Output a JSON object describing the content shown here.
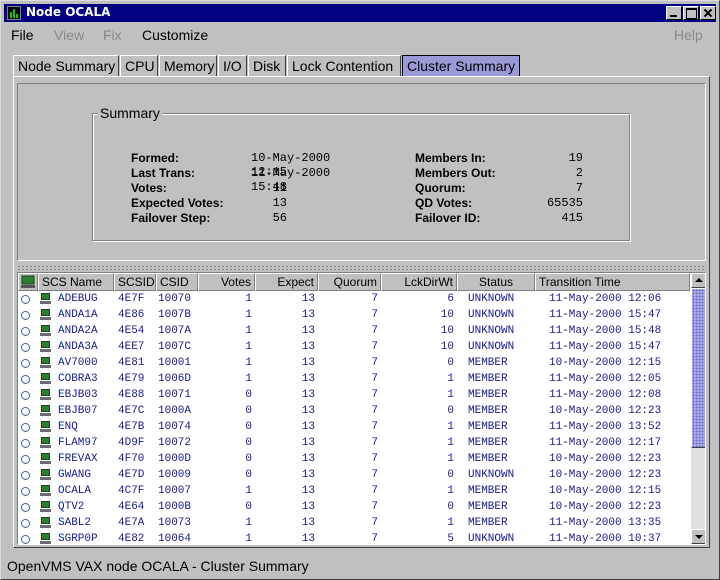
{
  "window": {
    "title": "Node OCALA"
  },
  "menu": {
    "file": "File",
    "view": "View",
    "fix": "Fix",
    "customize": "Customize",
    "help": "Help"
  },
  "tabs": [
    "Node Summary",
    "CPU",
    "Memory",
    "I/O",
    "Disk",
    "Lock Contention",
    "Cluster Summary"
  ],
  "active_tab": "Cluster Summary",
  "summary": {
    "legend": "Summary",
    "formed_label": "Formed:",
    "formed": "10-May-2000 12:15",
    "last_trans_label": "Last Trans:",
    "last_trans": "11-May-2000 15:48",
    "votes_label": "Votes:",
    "votes": "11",
    "expected_votes_label": "Expected Votes:",
    "expected_votes": "13",
    "failover_step_label": "Failover Step:",
    "failover_step": "56",
    "members_in_label": "Members In:",
    "members_in": "19",
    "members_out_label": "Members Out:",
    "members_out": "2",
    "quorum_label": "Quorum:",
    "quorum": "7",
    "qd_votes_label": "QD Votes:",
    "qd_votes": "65535",
    "failover_id_label": "Failover ID:",
    "failover_id": "415"
  },
  "table": {
    "columns": [
      "SCS Name",
      "SCSID",
      "CSID",
      "Votes",
      "Expect",
      "Quorum",
      "LckDirWt",
      "Status",
      "Transition Time"
    ],
    "rows": [
      [
        "ADEBUG",
        "4E7F",
        "10070",
        "1",
        "13",
        "7",
        "6",
        "UNKNOWN",
        "11-May-2000 12:06"
      ],
      [
        "ANDA1A",
        "4E86",
        "1007B",
        "1",
        "13",
        "7",
        "10",
        "UNKNOWN",
        "11-May-2000 15:47"
      ],
      [
        "ANDA2A",
        "4E54",
        "1007A",
        "1",
        "13",
        "7",
        "10",
        "UNKNOWN",
        "11-May-2000 15:48"
      ],
      [
        "ANDA3A",
        "4EE7",
        "1007C",
        "1",
        "13",
        "7",
        "10",
        "UNKNOWN",
        "11-May-2000 15:47"
      ],
      [
        "AV7000",
        "4E81",
        "10001",
        "1",
        "13",
        "7",
        "0",
        "MEMBER",
        "10-May-2000 12:15"
      ],
      [
        "COBRA3",
        "4E79",
        "1006D",
        "1",
        "13",
        "7",
        "1",
        "MEMBER",
        "11-May-2000 12:05"
      ],
      [
        "EBJB03",
        "4E88",
        "10071",
        "0",
        "13",
        "7",
        "1",
        "MEMBER",
        "11-May-2000 12:08"
      ],
      [
        "EBJB07",
        "4E7C",
        "1000A",
        "0",
        "13",
        "7",
        "0",
        "MEMBER",
        "10-May-2000 12:23"
      ],
      [
        "ENQ",
        "4E7B",
        "10074",
        "0",
        "13",
        "7",
        "1",
        "MEMBER",
        "11-May-2000 13:52"
      ],
      [
        "FLAM97",
        "4D9F",
        "10072",
        "0",
        "13",
        "7",
        "1",
        "MEMBER",
        "11-May-2000 12:17"
      ],
      [
        "FREVAX",
        "4F70",
        "1000D",
        "0",
        "13",
        "7",
        "1",
        "MEMBER",
        "10-May-2000 12:23"
      ],
      [
        "GWANG",
        "4E7D",
        "10009",
        "0",
        "13",
        "7",
        "0",
        "UNKNOWN",
        "10-May-2000 12:23"
      ],
      [
        "OCALA",
        "4C7F",
        "10007",
        "1",
        "13",
        "7",
        "1",
        "MEMBER",
        "10-May-2000 12:15"
      ],
      [
        "QTV2",
        "4E64",
        "1000B",
        "0",
        "13",
        "7",
        "0",
        "MEMBER",
        "10-May-2000 12:23"
      ],
      [
        "SABL2",
        "4E7A",
        "10073",
        "1",
        "13",
        "7",
        "1",
        "MEMBER",
        "11-May-2000 13:35"
      ],
      [
        "SGRP0P",
        "4E82",
        "10064",
        "1",
        "13",
        "7",
        "5",
        "UNKNOWN",
        "11-May-2000 10:37"
      ]
    ]
  },
  "status_bar": "OpenVMS VAX node OCALA - Cluster Summary",
  "colors": {
    "titlebar": "#000080",
    "active_tab": "#9a9ad8",
    "row_text": "#1a1a8a",
    "node_icon": "#2e7d32"
  }
}
